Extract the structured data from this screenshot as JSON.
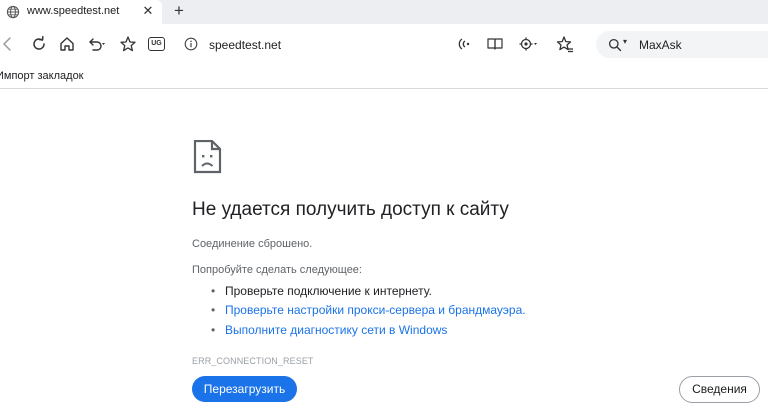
{
  "tab": {
    "title": "www.speedtest.net",
    "icon": "globe-icon",
    "close_glyph": "✕",
    "new_tab_glyph": "+"
  },
  "toolbar": {
    "icons": [
      "back-icon",
      "refresh-icon",
      "home-icon",
      "undo-icon",
      "favorite-star-icon",
      "ug-badge-icon",
      "read-aloud-icon",
      "reader-view-icon",
      "extensions-icon",
      "favorites-icon"
    ],
    "ug_label": "UG"
  },
  "address": {
    "url": "speedtest.net",
    "icon": "info-icon"
  },
  "search": {
    "engine": "MaxAsk",
    "icon": "search-icon"
  },
  "bookmarks": {
    "import_label": "Импорт закладок"
  },
  "error": {
    "icon": "sad-document-icon",
    "title": "Не удается получить доступ к сайту",
    "subtitle": "Соединение сброшено.",
    "try_label": "Попробуйте сделать следующее:",
    "suggestions": [
      {
        "text": "Проверьте подключение к интернету.",
        "link": false
      },
      {
        "text": "Проверьте настройки прокси-сервера и брандмауэра.",
        "link": true
      },
      {
        "text": "Выполните диагностику сети в Windows",
        "link": true
      }
    ],
    "code": "ERR_CONNECTION_RESET",
    "reload_label": "Перезагрузить",
    "details_label": "Сведения"
  },
  "colors": {
    "accent": "#1a73e8",
    "tabstrip": "#eceef1"
  }
}
